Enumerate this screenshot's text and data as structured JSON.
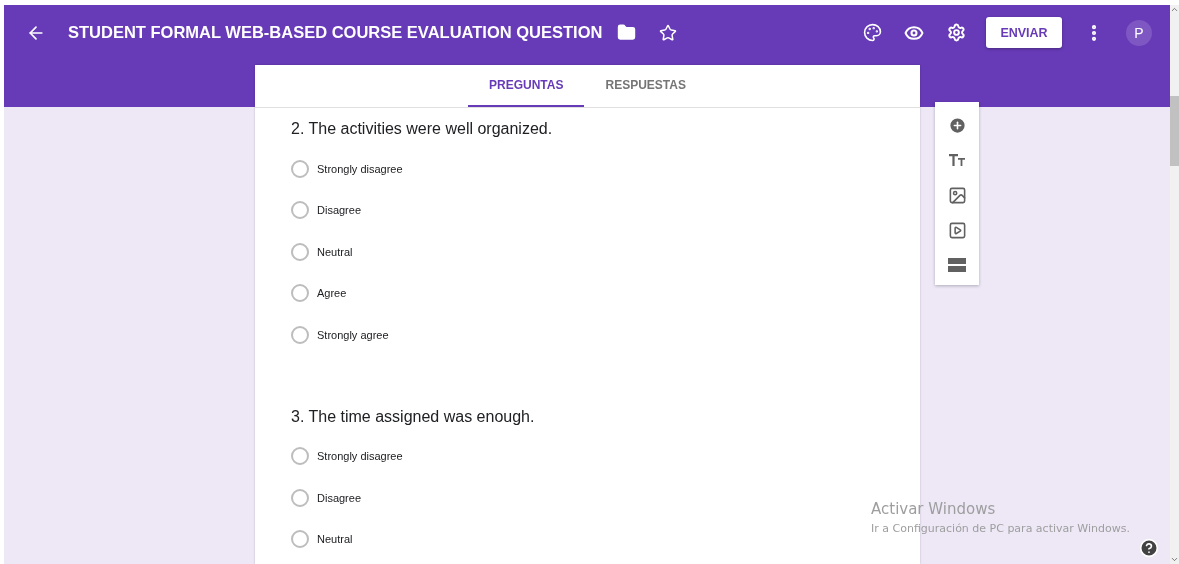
{
  "header": {
    "title": "STUDENT FORMAL WEB-BASED COURSE EVALUATION QUESTION",
    "send_button": "ENVIAR",
    "avatar": "P"
  },
  "tabs": [
    {
      "label": "PREGUNTAS",
      "selected": true
    },
    {
      "label": "RESPUESTAS",
      "selected": false
    }
  ],
  "questions": [
    {
      "title": "2. The activities were well organized.",
      "options": [
        {
          "label": "Strongly disagree",
          "selected": false
        },
        {
          "label": "Disagree",
          "selected": false
        },
        {
          "label": "Neutral",
          "selected": false
        },
        {
          "label": "Agree",
          "selected": false
        },
        {
          "label": "Strongly agree",
          "selected": false
        }
      ]
    },
    {
      "title": "3. The time assigned was enough.",
      "options": [
        {
          "label": "Strongly disagree",
          "selected": false
        },
        {
          "label": "Disagree",
          "selected": false
        },
        {
          "label": "Neutral",
          "selected": false
        }
      ]
    }
  ],
  "activation_notice": {
    "title": "Activar Windows",
    "message": "Ir a Configuración de PC para activar Windows."
  }
}
